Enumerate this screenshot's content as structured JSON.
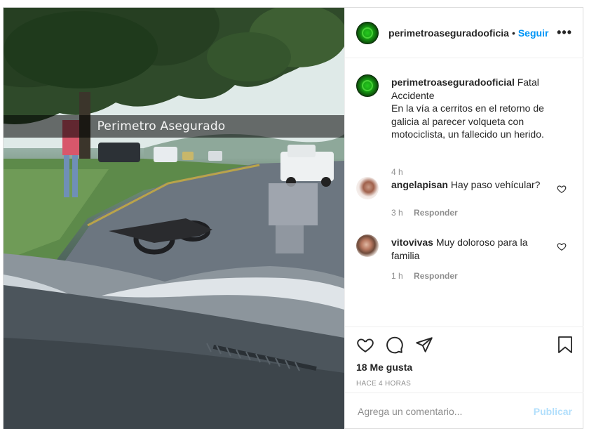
{
  "post": {
    "image_caption": "Perimetro Asegurado"
  },
  "header": {
    "username": "perimetroaseguradooficia",
    "separator": "•",
    "follow_label": "Seguir",
    "more_icon": "more-horizontal-icon"
  },
  "caption": {
    "username": "perimetroaseguradooficial",
    "text": "Fatal Accidente\nEn la vía a cerritos en el retorno de galicia al parecer volqueta con motociclista, un fallecido un herido.",
    "time": "4 h"
  },
  "comments": [
    {
      "username": "angelapisan",
      "text": "Hay paso vehícular?",
      "time": "3 h",
      "reply_label": "Responder"
    },
    {
      "username": "vitovivas",
      "text": "Muy doloroso para la familia",
      "time": "1 h",
      "reply_label": "Responder"
    }
  ],
  "actions": {
    "likes": "18 Me gusta",
    "timestamp": "HACE 4 HORAS",
    "icons": [
      "heart-icon",
      "comment-icon",
      "share-icon",
      "bookmark-icon"
    ]
  },
  "add_comment": {
    "placeholder": "Agrega un comentario...",
    "post_label": "Publicar"
  },
  "colors": {
    "link_blue": "#0095f6",
    "post_disabled": "#b2dffc",
    "muted": "#8e8e8e"
  }
}
